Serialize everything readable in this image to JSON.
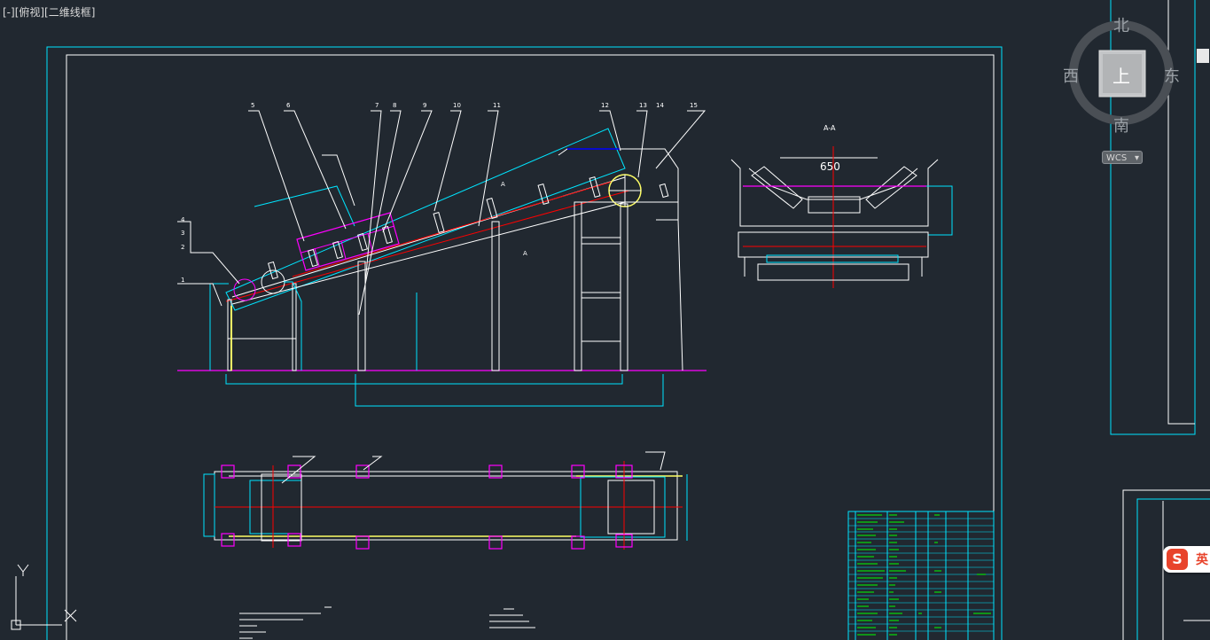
{
  "viewport": {
    "label": "[-][俯视][二维线框]"
  },
  "viewcube": {
    "north": "北",
    "south": "南",
    "east": "东",
    "west": "西",
    "top": "上",
    "wcs": "WCS"
  },
  "ucs": {
    "y": "Y",
    "x": "X"
  },
  "ime": {
    "logo": "S",
    "text": "英"
  },
  "colors": {
    "background": "#212830",
    "frame": "#00e5ff",
    "inner_frame": "#ffffff",
    "accent_red": "#ff0000",
    "accent_magenta": "#ff00ff",
    "accent_yellow": "#ffff66",
    "table_green": "#00ff00"
  },
  "drawing": {
    "part_numbers": [
      "5",
      "6",
      "7",
      "8",
      "9",
      "10",
      "11",
      "12",
      "13",
      "14",
      "15",
      "4",
      "3",
      "2",
      "1"
    ],
    "section_label": "A-A",
    "section_label_small": "A",
    "dimension_650": "650",
    "view_a_note": "A"
  }
}
